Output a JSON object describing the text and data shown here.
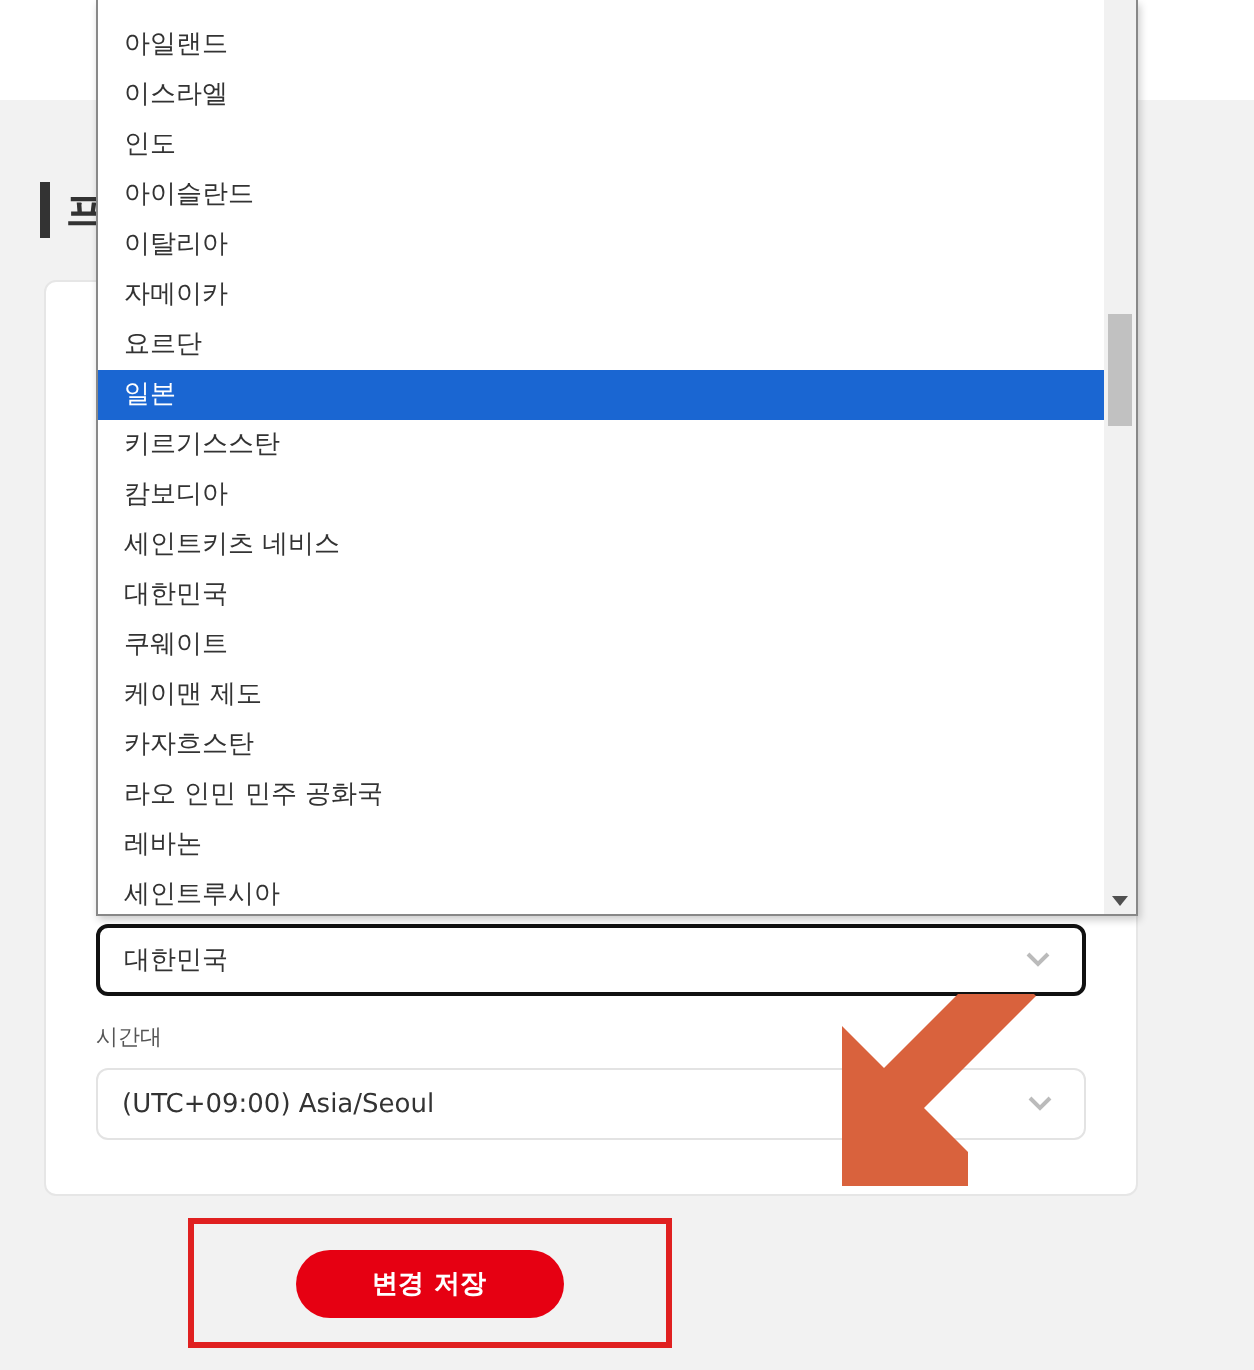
{
  "heading": "프",
  "country_select": {
    "value": "대한민국",
    "focused": true
  },
  "country_options": [
    {
      "label": "아일랜드",
      "selected": false
    },
    {
      "label": "이스라엘",
      "selected": false
    },
    {
      "label": "인도",
      "selected": false
    },
    {
      "label": "아이슬란드",
      "selected": false
    },
    {
      "label": "이탈리아",
      "selected": false
    },
    {
      "label": "자메이카",
      "selected": false
    },
    {
      "label": "요르단",
      "selected": false
    },
    {
      "label": "일본",
      "selected": true
    },
    {
      "label": "키르기스스탄",
      "selected": false
    },
    {
      "label": "캄보디아",
      "selected": false
    },
    {
      "label": "세인트키츠 네비스",
      "selected": false
    },
    {
      "label": "대한민국",
      "selected": false
    },
    {
      "label": "쿠웨이트",
      "selected": false
    },
    {
      "label": "케이맨 제도",
      "selected": false
    },
    {
      "label": "카자흐스탄",
      "selected": false
    },
    {
      "label": "라오 인민 민주 공화국",
      "selected": false
    },
    {
      "label": "레바논",
      "selected": false
    },
    {
      "label": "세인트루시아",
      "selected": false
    }
  ],
  "timezone": {
    "label": "시간대",
    "value": "(UTC+09:00) Asia/Seoul",
    "focused": false
  },
  "save_button": "변경 저장"
}
